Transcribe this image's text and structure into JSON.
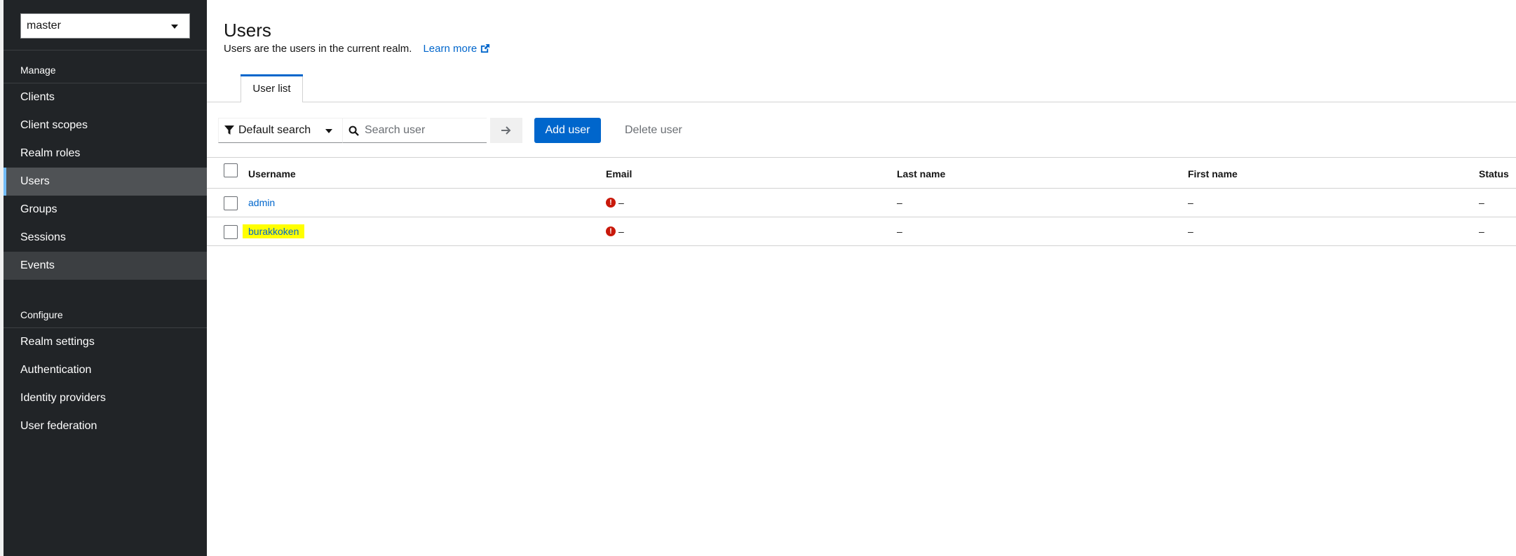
{
  "sidebar": {
    "realm": "master",
    "manage_title": "Manage",
    "manage_items": [
      "Clients",
      "Client scopes",
      "Realm roles",
      "Users",
      "Groups",
      "Sessions",
      "Events"
    ],
    "configure_title": "Configure",
    "configure_items": [
      "Realm settings",
      "Authentication",
      "Identity providers",
      "User federation"
    ],
    "active_item": "Users"
  },
  "header": {
    "title": "Users",
    "description": "Users are the users in the current realm.",
    "learn_more": "Learn more"
  },
  "tabs": [
    {
      "label": "User list"
    }
  ],
  "toolbar": {
    "filter_label": "Default search",
    "search_placeholder": "Search user",
    "add_user": "Add user",
    "delete_user": "Delete user"
  },
  "table": {
    "columns": [
      "Username",
      "Email",
      "Last name",
      "First name",
      "Status"
    ],
    "rows": [
      {
        "username": "admin",
        "email": "–",
        "last_name": "–",
        "first_name": "–",
        "status": "–",
        "highlighted": false
      },
      {
        "username": "burakkoken",
        "email": "–",
        "last_name": "–",
        "first_name": "–",
        "status": "–",
        "highlighted": true
      }
    ]
  },
  "colors": {
    "sidebar_bg": "#212427",
    "active_accent": "#73bcf7",
    "primary": "#0066cc",
    "warning": "#c9190b",
    "highlight": "#ffff00"
  }
}
